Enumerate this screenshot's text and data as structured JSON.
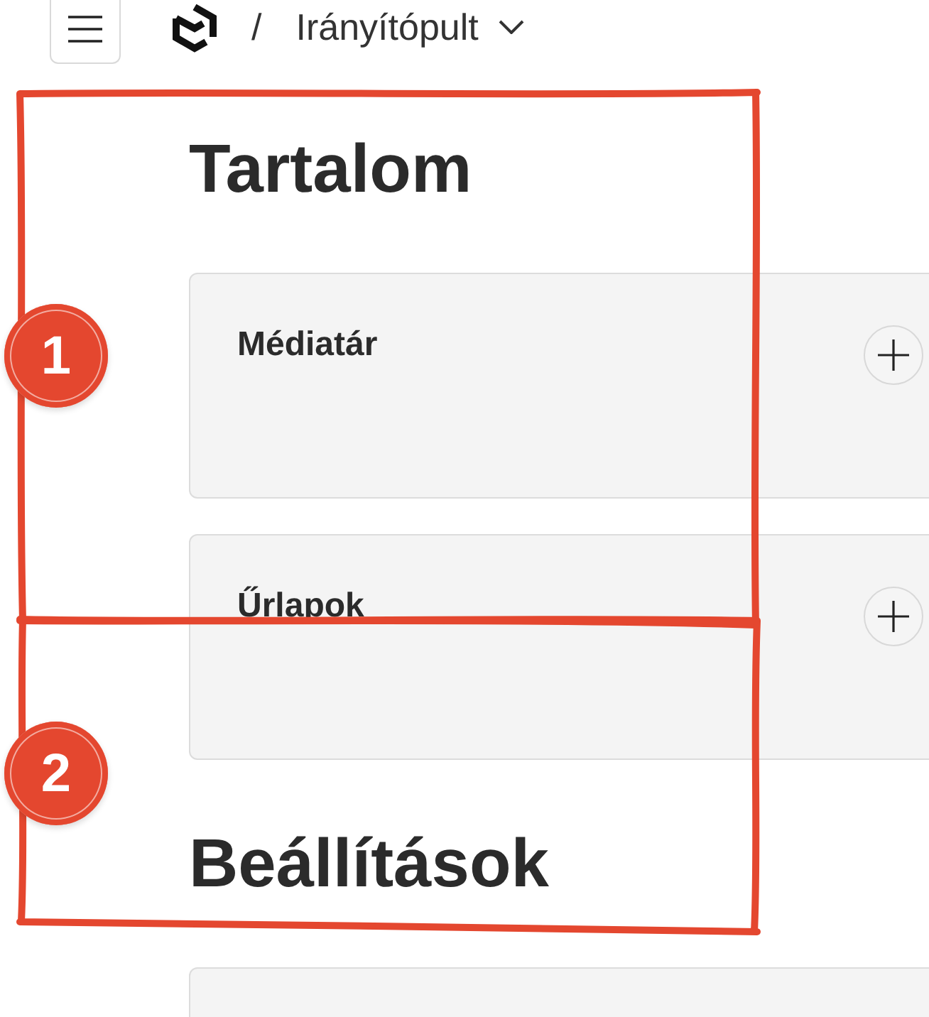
{
  "header": {
    "separator": "/",
    "page_title": "Irányítópult"
  },
  "sections": [
    {
      "title": "Tartalom",
      "cards": [
        {
          "kind": "collection",
          "title": "Médiatár"
        },
        {
          "kind": "collection",
          "title": "Űrlapok"
        }
      ]
    },
    {
      "title": "Beállítások",
      "cards": [
        {
          "kind": "collection"
        }
      ]
    }
  ],
  "annotations": [
    {
      "number": "1"
    },
    {
      "number": "2"
    }
  ]
}
